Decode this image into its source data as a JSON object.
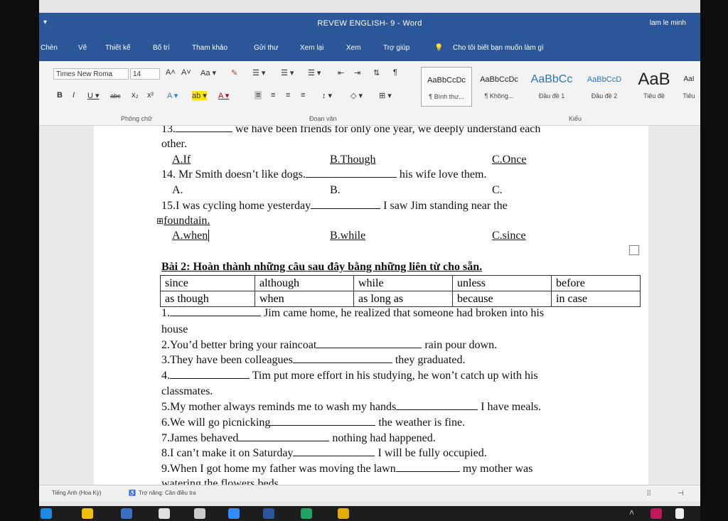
{
  "window": {
    "title": "REVEW ENGLISH- 9  -  Word",
    "user": "lam le minh",
    "quick_access": "▾"
  },
  "menu": {
    "items": [
      "Chèn",
      "Vẽ",
      "Thiết kế",
      "Bố trí",
      "Tham khảo",
      "Gửi thư",
      "Xem lại",
      "Xem",
      "Trợ giúp"
    ],
    "tell_me": "Cho tôi biết bạn muốn làm gì"
  },
  "ribbon": {
    "font_name": "Times New Roma",
    "font_size": "14",
    "group_font": "Phông chữ",
    "group_paragraph": "Đoạn văn",
    "group_styles": "Kiểu",
    "styles": [
      {
        "preview": "AaBbCcDc",
        "name": "¶ Bình thư..."
      },
      {
        "preview": "AaBbCcDc",
        "name": "¶ Không..."
      },
      {
        "preview": "AaBbCc",
        "name": "Đầu đề 1"
      },
      {
        "preview": "AaBbCcD",
        "name": "Đầu đề 2"
      },
      {
        "preview": "AaB",
        "name": "Tiêu đề"
      },
      {
        "preview": "AaI",
        "name": "Tiêu"
      }
    ]
  },
  "document": {
    "q13_num": "13.",
    "q13_text": " we have been friends for only one year, we deeply understand each",
    "q13_cont": "other.",
    "q13_a": "A.If",
    "q13_b": "B.Though",
    "q13_c": "C.Once",
    "q14_start": "14. Mr Smith doesn’t like dogs.",
    "q14_end": "his wife love them.",
    "q14_a": "A.",
    "q14_b": "B.",
    "q14_c": "C.",
    "q15_start": "15.I was cycling home yesterday",
    "q15_end": "I saw Jim standing near the",
    "q15_cont": "foundtain.",
    "q15_a": "A.when",
    "q15_b": "B.while",
    "q15_c": "C.since",
    "bai2_title": "Bài 2: Hoàn thành những câu sau đây bằng những liên từ cho sẵn.",
    "word_table": [
      [
        "since",
        "although",
        "while",
        "unless",
        "before"
      ],
      [
        "as though",
        "when",
        "as long as",
        "because",
        "in case"
      ]
    ],
    "s1_num": "1.",
    "s1_text": "Jim came home, he realized that someone had broken into his",
    "s1_cont": "house",
    "s2_start": "2.You’d better bring your raincoat",
    "s2_end": "rain pour down.",
    "s3_start": "3.They have been colleagues",
    "s3_end": "they graduated.",
    "s4_num": "4.",
    "s4_text": "Tim put more effort in his studying, he won’t catch up with his",
    "s4_cont": "classmates.",
    "s5_start": "5.My mother always reminds me to wash my hands",
    "s5_end": "I have meals.",
    "s6_start": "6.We will go picnicking",
    "s6_end": "the weather is fine.",
    "s7_start": "7.James behaved",
    "s7_end": "nothing had happened.",
    "s8_start": "8.I can’t make it on Saturday",
    "s8_end": "I will be fully occupied.",
    "s9_start": "9.When I got home my father was moving the lawn",
    "s9_end": "my mother was",
    "s9_cont": "watering the flowers beds"
  },
  "status": {
    "language": "Tiếng Anh (Hoa Kỳ)",
    "accessibility": "Trợ năng: Cần điều tra"
  },
  "colors": {
    "word_blue": "#2b579a",
    "page": "#ffffff",
    "taskbar": "#1d1d1d"
  }
}
